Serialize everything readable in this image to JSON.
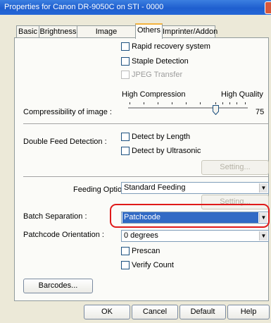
{
  "window": {
    "title": "Properties for Canon DR-9050C on STI - 0000"
  },
  "tabs": [
    "Basic",
    "Brightness",
    "Image processing",
    "Others",
    "Imprinter/Addon"
  ],
  "active_tab": "Others",
  "options": {
    "rapid_recovery": "Rapid recovery system",
    "staple_detection": "Staple Detection",
    "jpeg_transfer": "JPEG Transfer"
  },
  "compression": {
    "label": "Compressibility of image :",
    "low_label": "High Compression",
    "high_label": "High Quality",
    "value": "75"
  },
  "double_feed": {
    "label": "Double Feed Detection :",
    "by_length": "Detect by Length",
    "by_ultrasonic": "Detect by Ultrasonic",
    "setting_button": "Setting..."
  },
  "feeding": {
    "label": "Feeding Option :",
    "value": "Standard Feeding",
    "setting_button": "Setting..."
  },
  "batch": {
    "label": "Batch Separation :",
    "value": "Patchcode"
  },
  "patchcode": {
    "label": "Patchcode Orientation :",
    "value": "0 degrees"
  },
  "prescan": "Prescan",
  "verify_count": "Verify Count",
  "barcodes_button": "Barcodes...",
  "footer": {
    "ok": "OK",
    "cancel": "Cancel",
    "default": "Default",
    "help": "Help"
  },
  "colors": {
    "accent": "#316ac5",
    "highlight_ring": "#e01a1a",
    "titlebar": "#1f5fcf"
  }
}
